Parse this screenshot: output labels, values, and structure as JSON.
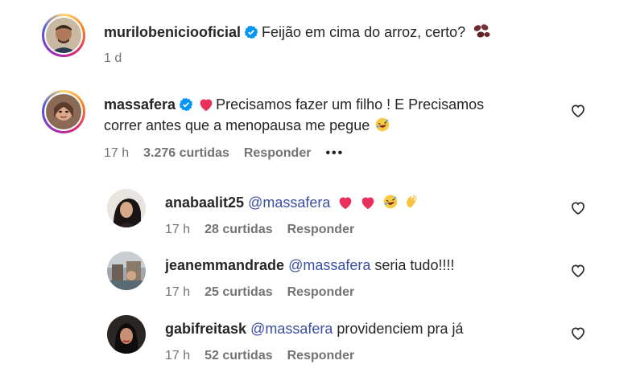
{
  "post": {
    "username": "murilobeniciooficial",
    "caption": "Feijão em cima do arroz, certo?",
    "time": "1 d"
  },
  "comments": [
    {
      "username": "massafera",
      "text": "Precisamos fazer um filho ! E Precisamos correr antes que a menopausa me pegue",
      "time": "17 h",
      "likes": "3.276 curtidas",
      "reply_label": "Responder",
      "more_label": "•••"
    }
  ],
  "replies": [
    {
      "username": "anabaalit25",
      "mention": "@massafera",
      "text": "",
      "time": "17 h",
      "likes": "28 curtidas",
      "reply_label": "Responder"
    },
    {
      "username": "jeanemmandrade",
      "mention": "@massafera",
      "text": "seria tudo!!!!",
      "time": "17 h",
      "likes": "25 curtidas",
      "reply_label": "Responder"
    },
    {
      "username": "gabifreitask",
      "mention": "@massafera",
      "text": "providenciem pra já",
      "time": "17 h",
      "likes": "52 curtidas",
      "reply_label": "Responder"
    }
  ],
  "colors": {
    "verified": "#0095f6",
    "heart_emoji": "#e8305a",
    "mention": "#3a4fa3",
    "muted": "#737373"
  },
  "icons": {
    "verified": "verified-badge-icon",
    "like": "heart-outline-icon",
    "beans": "beans-emoji-icon",
    "heart_emoji": "pink-heart-emoji-icon",
    "laugh": "rolling-laughing-emoji-icon",
    "clap": "clapping-hands-emoji-icon"
  }
}
